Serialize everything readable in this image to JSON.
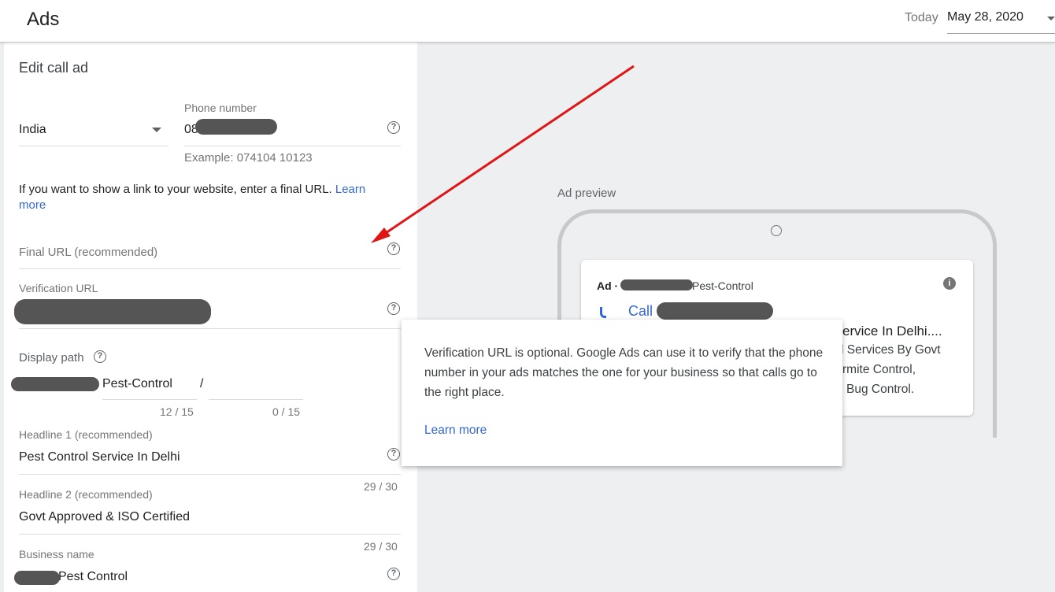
{
  "header": {
    "title": "Ads",
    "today_label": "Today",
    "date": "May 28, 2020"
  },
  "form": {
    "heading": "Edit call ad",
    "country": "India",
    "phone_label": "Phone number",
    "phone_prefix": "08",
    "phone_example": "Example: 074104 10123",
    "website_note": "If you want to show a link to your website, enter a final URL.",
    "learn_more_1": "Learn",
    "learn_more_2": "more",
    "final_url_placeholder": "Final URL (recommended)",
    "verification_label": "Verification URL",
    "display_path_label": "Display path",
    "path1": "Pest-Control",
    "path_separator": "/",
    "path1_count": "12 / 15",
    "path2_count": "0 / 15",
    "headline1_label": "Headline 1 (recommended)",
    "headline1": "Pest Control Service In Delhi",
    "headline1_count": "29 / 30",
    "headline2_label": "Headline 2 (recommended)",
    "headline2": "Govt Approved & ISO Certified",
    "headline2_count": "29 / 30",
    "business_label": "Business name",
    "business_suffix": "Pest Control"
  },
  "preview": {
    "label": "Ad preview",
    "ad_badge": "Ad ·",
    "ad_path": "Pest-Control",
    "call_label": "Call",
    "line1": "ervice In Delhi....",
    "line2": "l Services By Govt",
    "line3": "rmite Control,",
    "line4": "Bug Control."
  },
  "tooltip": {
    "text": "Verification URL is optional. Google Ads can use it to verify that the phone number in your ads matches the one for your business so that calls go to the right place.",
    "link": "Learn more"
  },
  "colors": {
    "accent": "#3367d6",
    "arrow": "#e01515",
    "redaction": "#555555"
  }
}
